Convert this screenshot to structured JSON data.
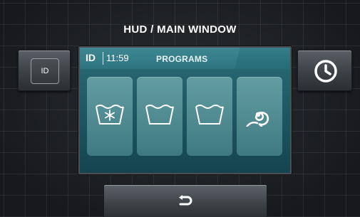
{
  "header": {
    "title": "HUD / MAIN WINDOW"
  },
  "left_button": {
    "label": "ID"
  },
  "right_button": {
    "icon": "clock-icon"
  },
  "screen": {
    "id_label": "ID",
    "time": "11:59",
    "title": "PROGRAMS",
    "programs": [
      {
        "icon": "cold-wash-snowflake-icon"
      },
      {
        "icon": "wash-tub-icon"
      },
      {
        "icon": "wash-tub-icon"
      },
      {
        "icon": "spin-spiral-icon"
      }
    ]
  },
  "footer": {
    "icon": "back-arrow-icon"
  },
  "colors": {
    "screen": "#1d5661",
    "background": "#1d2024",
    "text": "#ffffff"
  }
}
